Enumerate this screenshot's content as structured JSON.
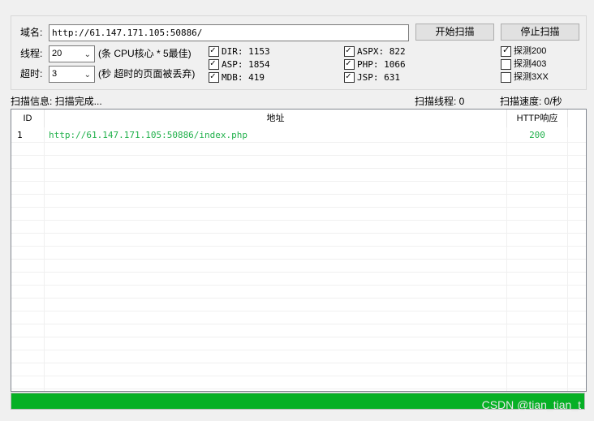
{
  "form": {
    "domain_label": "域名:",
    "domain_value": "http://61.147.171.105:50886/",
    "threads_label": "线程:",
    "threads_value": "20",
    "threads_hint": "(条 CPU核心 * 5最佳)",
    "timeout_label": "超时:",
    "timeout_value": "3",
    "timeout_hint": "(秒 超时的页面被丢弃)",
    "start_button": "开始扫描",
    "stop_button": "停止扫描"
  },
  "dictionaries": [
    {
      "label": "DIR: 1153",
      "checked": true
    },
    {
      "label": "ASP: 1854",
      "checked": true
    },
    {
      "label": "MDB: 419",
      "checked": true
    },
    {
      "label": "ASPX: 822",
      "checked": true
    },
    {
      "label": "PHP: 1066",
      "checked": true
    },
    {
      "label": "JSP: 631",
      "checked": true
    }
  ],
  "probes": [
    {
      "label": "探测200",
      "checked": true
    },
    {
      "label": "探测403",
      "checked": false
    },
    {
      "label": "探测3XX",
      "checked": false
    }
  ],
  "status": {
    "info": "扫描信息: 扫描完成...",
    "threads": "扫描线程: 0",
    "speed": "扫描速度: 0/秒"
  },
  "table": {
    "headers": [
      "ID",
      "地址",
      "HTTP响应"
    ],
    "rows": [
      {
        "id": "1",
        "url": "http://61.147.171.105:50886/index.php",
        "code": "200"
      }
    ]
  },
  "progress": {
    "value": 1.0,
    "color": "#06b025"
  },
  "watermark": "CSDN @tian_tian_t",
  "colors": {
    "result_text": "#22b14c"
  }
}
